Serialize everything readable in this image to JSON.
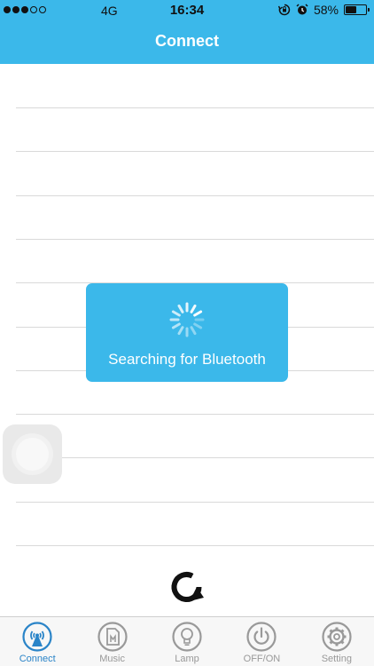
{
  "status_bar": {
    "network": "4G",
    "time": "16:34",
    "battery_percent_label": "58%",
    "battery_level": 0.58,
    "signal_filled": 3,
    "signal_total": 5,
    "icons": [
      "rotation-lock-icon",
      "alarm-icon",
      "battery-icon"
    ]
  },
  "header": {
    "title": "Connect"
  },
  "list": {
    "row_count": 11
  },
  "toast": {
    "message": "Searching for Bluetooth",
    "icon": "spinner-icon"
  },
  "refresh": {
    "icon": "refresh-icon"
  },
  "tabs": [
    {
      "label": "Connect",
      "icon": "bluetooth-tower-icon",
      "active": true
    },
    {
      "label": "Music",
      "icon": "music-file-icon",
      "active": false
    },
    {
      "label": "Lamp",
      "icon": "lamp-bulb-icon",
      "active": false
    },
    {
      "label": "OFF/ON",
      "icon": "power-icon",
      "active": false
    },
    {
      "label": "Setting",
      "icon": "gear-icon",
      "active": false
    }
  ],
  "colors": {
    "accent": "#3bb8ea",
    "active_tab": "#2a84c8",
    "inactive_tab": "#999999",
    "divider": "#d9d9d9"
  }
}
